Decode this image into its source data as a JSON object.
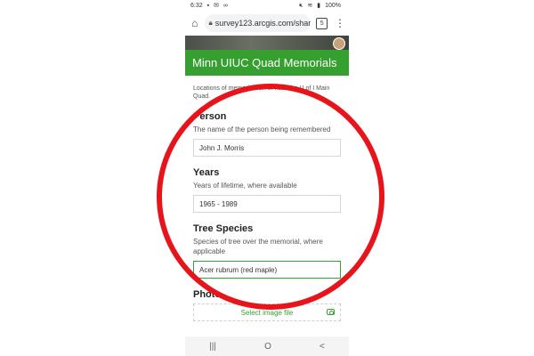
{
  "status_bar": {
    "time": "6:32",
    "left_icons": [
      "gallery-icon",
      "mail-icon",
      "voicemail-icon"
    ],
    "right_icons": [
      "mute-icon",
      "wifi-icon",
      "signal-icon"
    ],
    "battery": "100%"
  },
  "browser": {
    "url": "survey123.arcgis.com/shar",
    "tab_count": "5"
  },
  "form": {
    "title": "Minn UIUC Quad Memorials",
    "description": "Locations of memorials on or near the U of I Main Quad.",
    "fields": [
      {
        "label": "Person",
        "help": "The name of the person being remembered",
        "value": "John J. Morris"
      },
      {
        "label": "Years",
        "help": "Years of lifetime, where available",
        "value": "1965 - 1989"
      },
      {
        "label": "Tree Species",
        "help": "Species of tree over the memorial, where applicable",
        "value": "Acer rubrum (red maple)"
      }
    ],
    "photo": {
      "label": "Photo",
      "select_label": "Select image file"
    }
  },
  "nav": {
    "recent_symbol": "|||",
    "home_symbol": "O",
    "back_symbol": "<"
  },
  "colors": {
    "header_green": "#35a02f",
    "annotation_red": "#e8141b"
  }
}
